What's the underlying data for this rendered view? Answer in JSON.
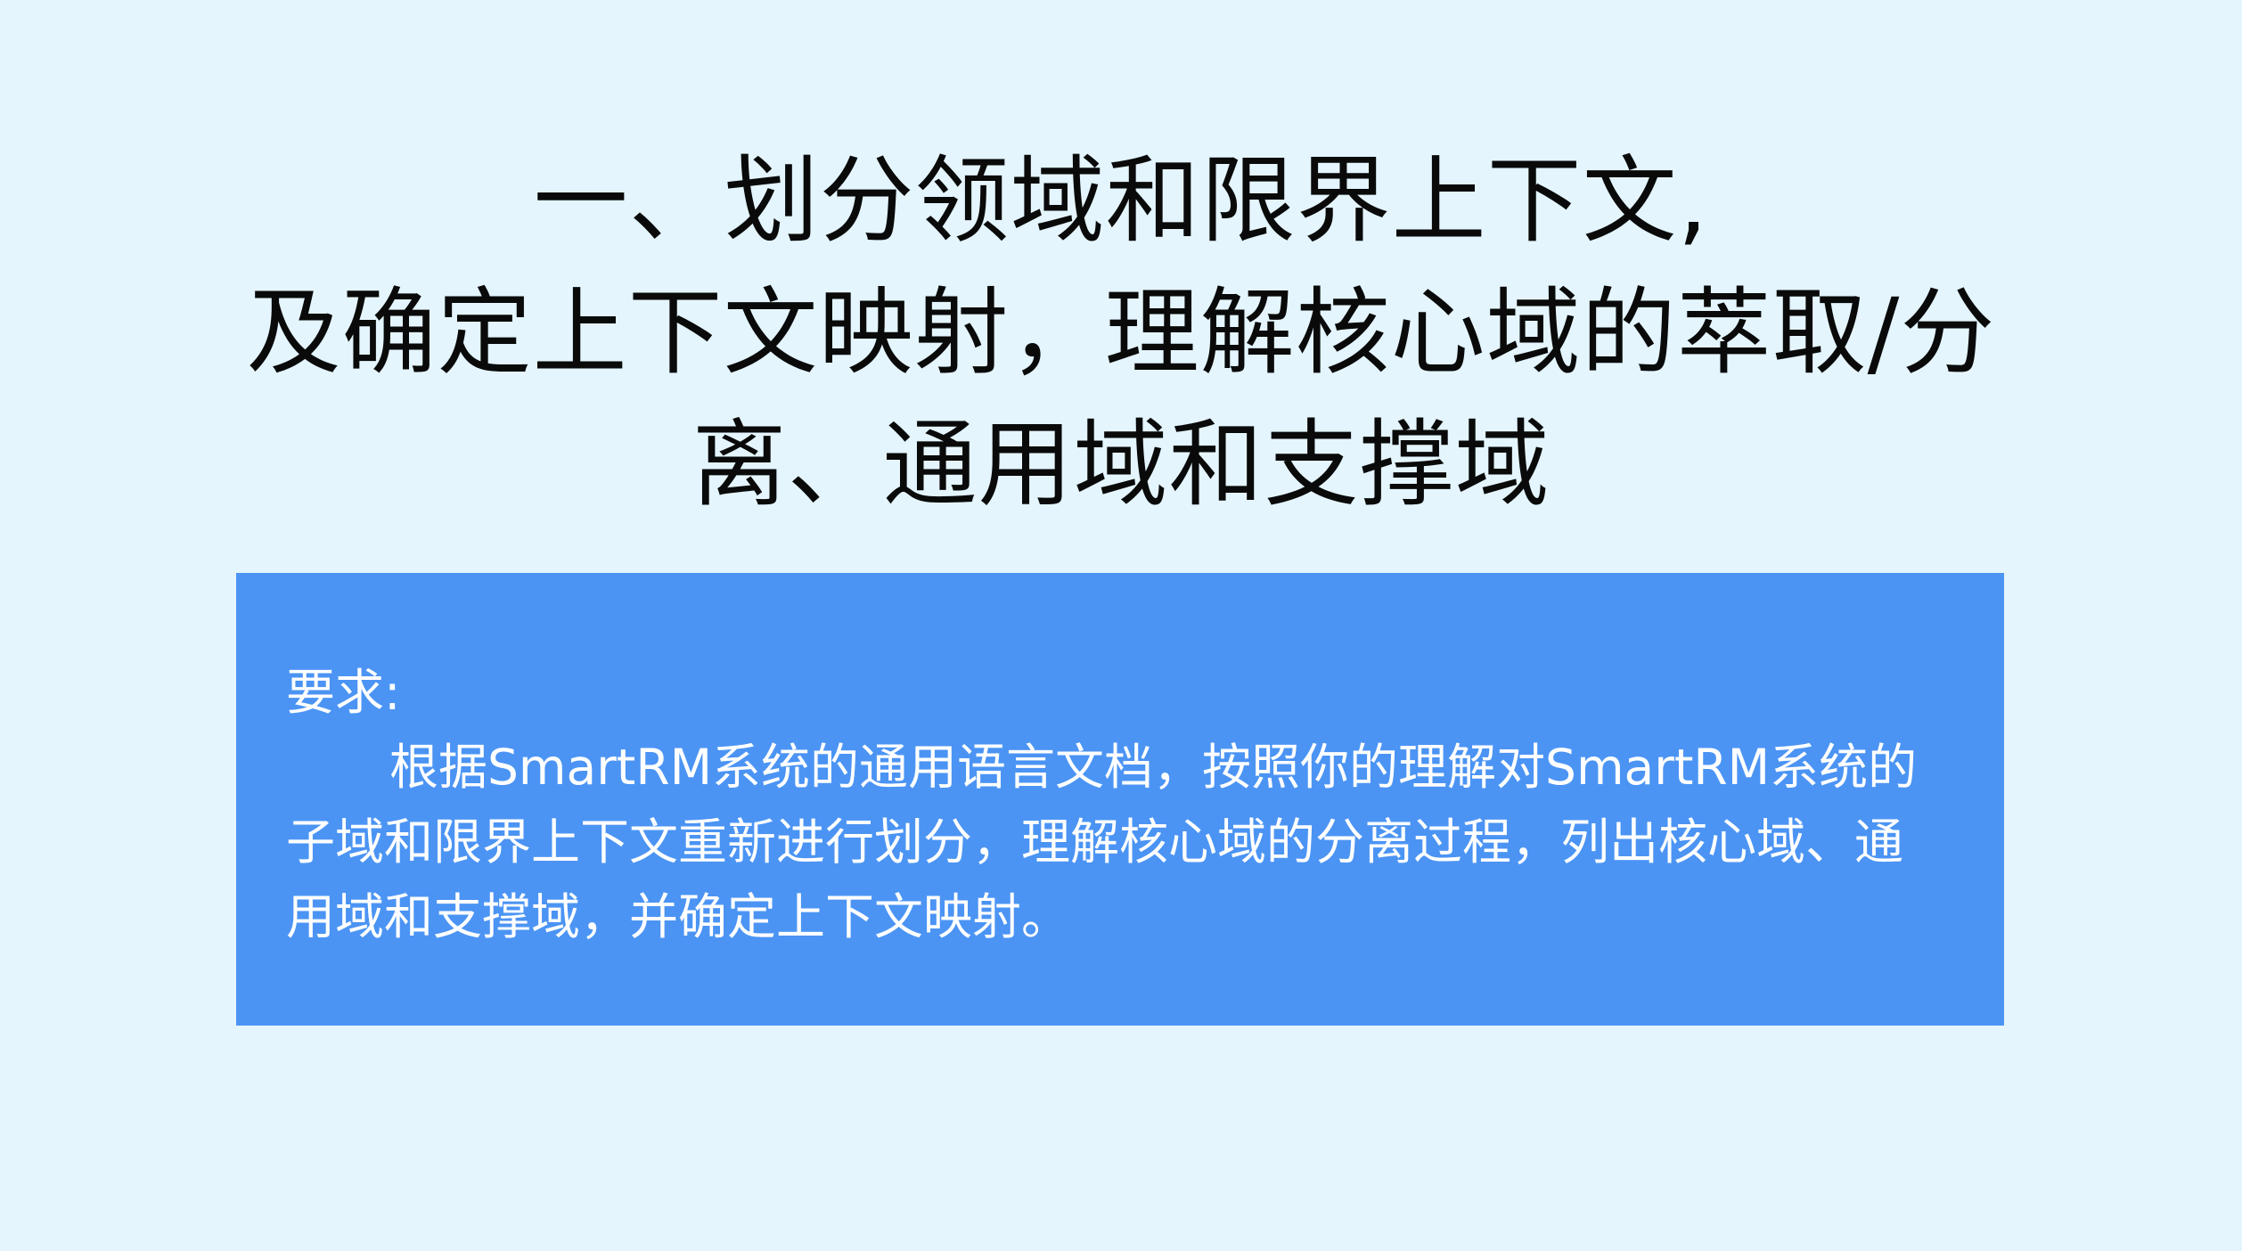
{
  "slide": {
    "title_lines": [
      "一、划分领域和限界上下文,",
      "及确定上下文映射，理解核心域的萃取/分",
      "离、通用域和支撑域"
    ]
  },
  "requirement": {
    "heading": "要求:",
    "body": "根据SmartRM系统的通用语言文档，按照你的理解对SmartRM系统的子域和限界上下文重新进行划分，理解核心域的分离过程，列出核心域、通用域和支撑域，并确定上下文映射。"
  },
  "colors": {
    "background": "#e4f5fd",
    "panel": "#4b94f4",
    "title_text": "#0a0a0a",
    "panel_text": "#ffffff"
  }
}
